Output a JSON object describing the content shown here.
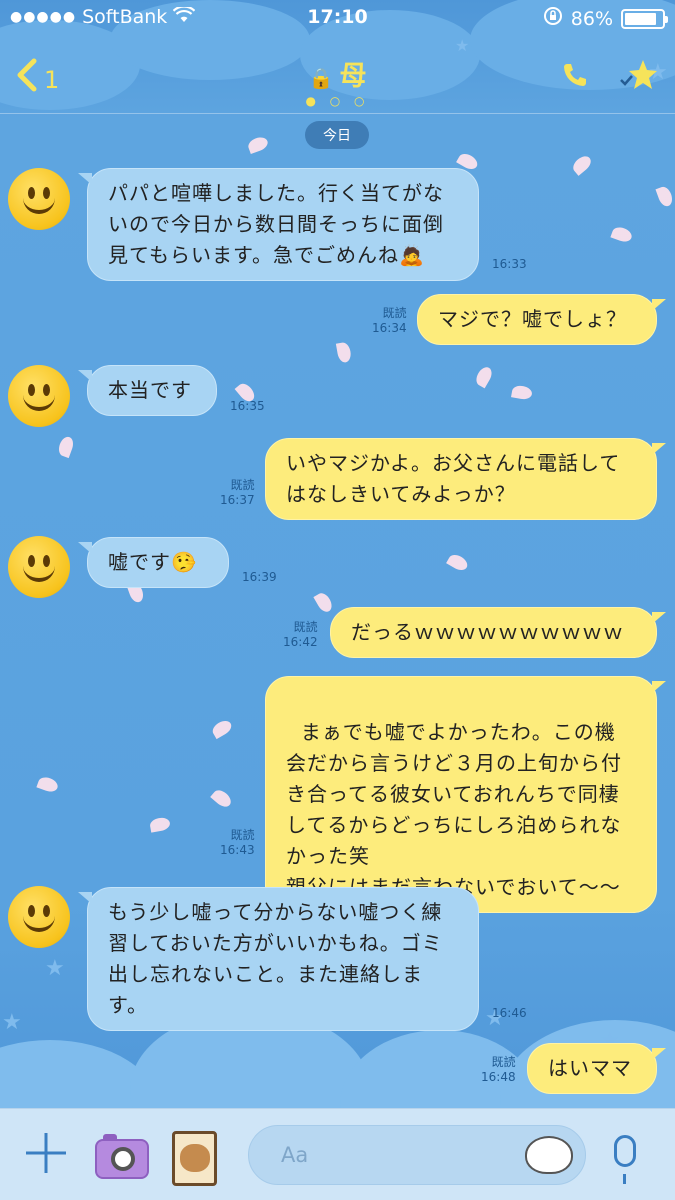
{
  "status_bar": {
    "signal_dots": "●●●●●",
    "carrier": "SoftBank",
    "wifi_icon": "wifi-icon",
    "time": "17:10",
    "battery_percent": "86%",
    "battery_level": 0.86
  },
  "header": {
    "back_count": "1",
    "chat_title": "母",
    "pager": "● ○ ○"
  },
  "date_chip": "今日",
  "messages": [
    {
      "side": "in",
      "text": "パパと喧嘩しました。行く当てがないので今日から数日間そっちに面倒見てもらいます。急でごめんね",
      "emoji": "🙇",
      "time": "16:33"
    },
    {
      "side": "out",
      "text": "マジで？嘘でしょ？",
      "read": "既読",
      "time": "16:34"
    },
    {
      "side": "in",
      "text": "本当です",
      "time": "16:35"
    },
    {
      "side": "out",
      "text": "いやマジかよ。お父さんに電話してはなしきいてみよっか？",
      "read": "既読",
      "time": "16:37"
    },
    {
      "side": "in",
      "text": "嘘です",
      "emoji": "🤥",
      "time": "16:39"
    },
    {
      "side": "out",
      "text": "だっるｗｗｗｗｗｗｗｗｗｗ",
      "read": "既読",
      "time": "16:42"
    },
    {
      "side": "out",
      "text": "まぁでも嘘でよかったわ。この機会だから言うけど３月の上旬から付き合ってる彼女いておれんちで同棲してるからどっちにしろ泊められなかった笑\n親父にはまだ言わないでおいて〜〜",
      "read": "既読",
      "time": "16:43"
    },
    {
      "side": "in",
      "text": "もう少し嘘って分からない嘘つく練習しておいた方がいいかもね。ゴミ出し忘れないこと。また連絡します。",
      "time": "16:46"
    },
    {
      "side": "out",
      "text": "はいママ",
      "read": "既読",
      "time": "16:48"
    }
  ],
  "input": {
    "placeholder": "Aa"
  },
  "colors": {
    "background": "#5b9fd9",
    "incoming_bubble": "#a8d4f3",
    "outgoing_bubble": "#fdec7c",
    "header_accent": "#f6e35a"
  }
}
